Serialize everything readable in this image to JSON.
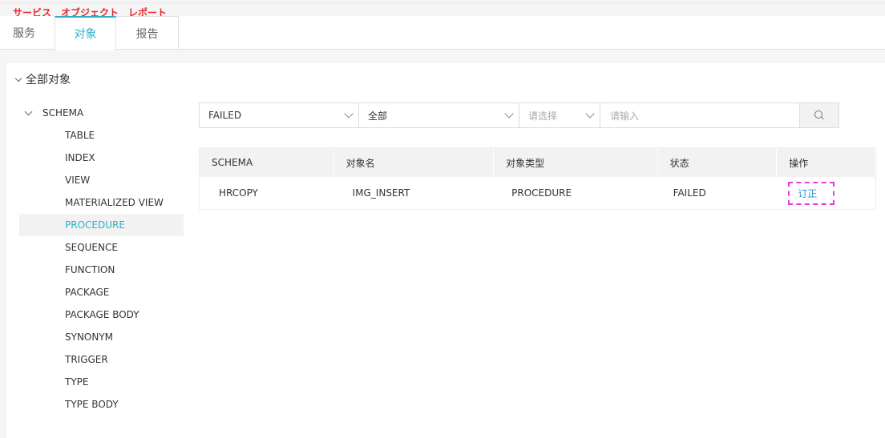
{
  "annotation_labels": [
    "サービス",
    "オブジェクト",
    "レポート"
  ],
  "tabs": [
    {
      "label": "服务"
    },
    {
      "label": "对象"
    },
    {
      "label": "报告"
    }
  ],
  "tree": {
    "root_label": "全部对象",
    "schema_label": "SCHEMA",
    "items": [
      "TABLE",
      "INDEX",
      "VIEW",
      "MATERIALIZED VIEW",
      "PROCEDURE",
      "SEQUENCE",
      "FUNCTION",
      "PACKAGE",
      "PACKAGE BODY",
      "SYNONYM",
      "TRIGGER",
      "TYPE",
      "TYPE BODY"
    ],
    "active_item": "PROCEDURE"
  },
  "filters": {
    "status_value": "FAILED",
    "scope_value": "全部",
    "field_placeholder": "请选择",
    "search_placeholder": "请输入"
  },
  "table": {
    "headers": [
      "SCHEMA",
      "对象名",
      "对象类型",
      "状态",
      "操作"
    ],
    "rows": [
      {
        "schema": "HRCOPY",
        "name": "IMG_INSERT",
        "type": "PROCEDURE",
        "status": "FAILED",
        "action": "订正"
      }
    ]
  },
  "colors": {
    "accent": "#2cb1c8",
    "annotation": "#e8262b",
    "highlight_box": "#e53ae2",
    "link": "#2b8fd6"
  },
  "icons": [
    "chevron-down-icon",
    "search-icon"
  ]
}
